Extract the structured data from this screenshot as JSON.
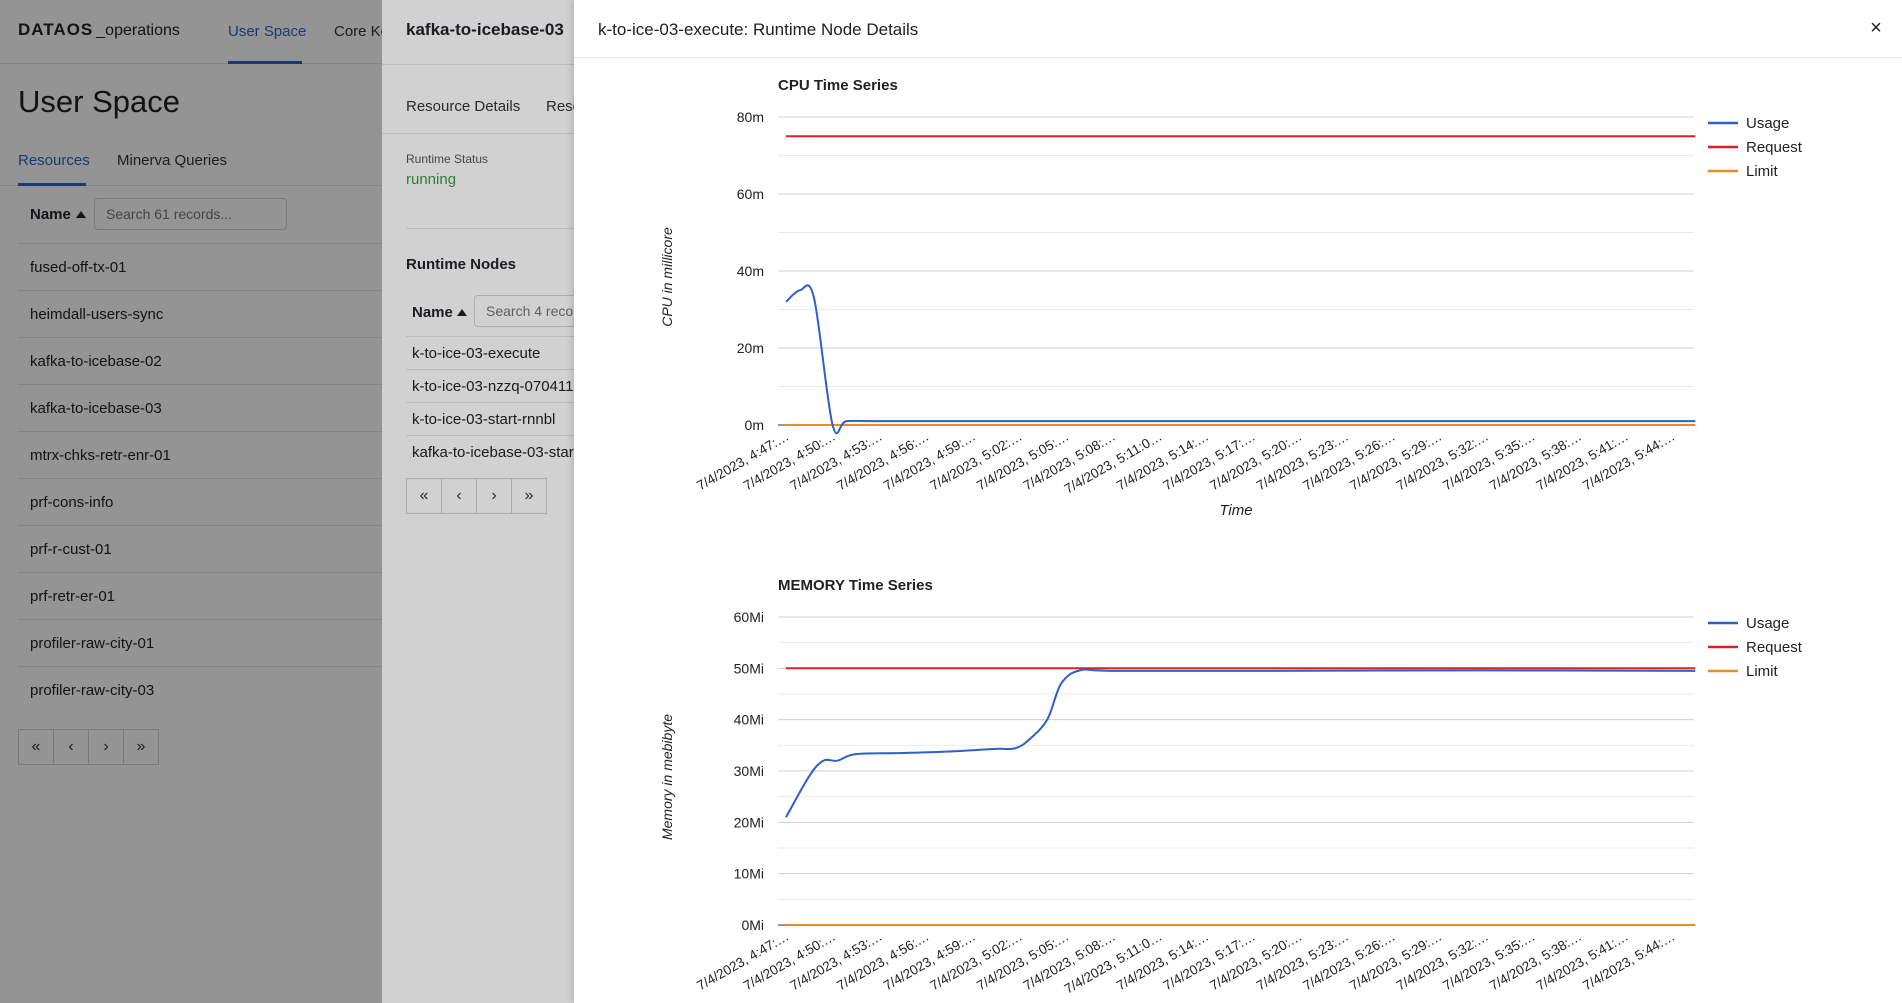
{
  "app": {
    "logo_brand": "DATAOS",
    "logo_suffix": "_operations",
    "nav": [
      {
        "label": "User Space",
        "active": true
      },
      {
        "label": "Core Ke"
      }
    ]
  },
  "user_space": {
    "title": "User Space",
    "tabs": [
      {
        "label": "Resources",
        "active": true
      },
      {
        "label": "Minerva Queries"
      }
    ],
    "table": {
      "name_header": "Name",
      "search_placeholder": "Search 61 records...",
      "rows": [
        "fused-off-tx-01",
        "heimdall-users-sync",
        "kafka-to-icebase-02",
        "kafka-to-icebase-03",
        "mtrx-chks-retr-enr-01",
        "prf-cons-info",
        "prf-r-cust-01",
        "prf-retr-er-01",
        "profiler-raw-city-01",
        "profiler-raw-city-03"
      ]
    },
    "pager": [
      "«",
      "‹",
      "›",
      "»"
    ]
  },
  "resource_panel": {
    "title": "kafka-to-icebase-03",
    "tabs": [
      "Resource Details",
      "Reso"
    ],
    "runtime_status_label": "Runtime Status",
    "runtime_status_value": "running",
    "runtime_nodes_title": "Runtime Nodes",
    "name_header": "Name",
    "search_placeholder": "Search 4 reco",
    "nodes": [
      "k-to-ice-03-execute",
      "k-to-ice-03-nzzq-070411",
      "k-to-ice-03-start-rnnbl",
      "kafka-to-icebase-03-star"
    ],
    "pager": [
      "«",
      "‹",
      "›",
      "»"
    ]
  },
  "details_drawer": {
    "title": "k-to-ice-03-execute: Runtime Node Details",
    "close_label": "×",
    "colors": {
      "usage": "#2f5fc8",
      "request": "#d6202c",
      "limit": "#f08a1c",
      "grid": "#d9d9d9"
    }
  },
  "chart_data": [
    {
      "type": "line",
      "title": "CPU Time Series",
      "xlabel": "Time",
      "ylabel": "CPU in millicore",
      "y_ticks": [
        "0m",
        "20m",
        "40m",
        "60m",
        "80m"
      ],
      "ylim": [
        0,
        80
      ],
      "x_ticks": [
        "7/4/2023, 4:47:…",
        "7/4/2023, 4:50:…",
        "7/4/2023, 4:53:…",
        "7/4/2023, 4:56:…",
        "7/4/2023, 4:59:…",
        "7/4/2023, 5:02:…",
        "7/4/2023, 5:05:…",
        "7/4/2023, 5:08:…",
        "7/4/2023, 5:11:0…",
        "7/4/2023, 5:14:…",
        "7/4/2023, 5:17:…",
        "7/4/2023, 5:20:…",
        "7/4/2023, 5:23:…",
        "7/4/2023, 5:26:…",
        "7/4/2023, 5:29:…",
        "7/4/2023, 5:32:…",
        "7/4/2023, 5:35:…",
        "7/4/2023, 5:38:…",
        "7/4/2023, 5:41:…",
        "7/4/2023, 5:44:…"
      ],
      "legend_position": "right",
      "series": [
        {
          "name": "Usage",
          "color": "#2f5fc8",
          "points": [
            [
              0,
              32
            ],
            [
              0.3,
              35
            ],
            [
              0.6,
              33
            ],
            [
              1.0,
              0
            ],
            [
              1.3,
              1
            ],
            [
              2,
              1
            ],
            [
              5,
              1
            ],
            [
              10,
              1
            ],
            [
              15,
              1
            ],
            [
              19.5,
              1
            ]
          ]
        },
        {
          "name": "Request",
          "color": "#d6202c",
          "points": [
            [
              0,
              75
            ],
            [
              19.5,
              75
            ]
          ]
        },
        {
          "name": "Limit",
          "color": "#f08a1c",
          "points": [
            [
              0,
              0
            ],
            [
              19.5,
              0
            ]
          ]
        }
      ]
    },
    {
      "type": "line",
      "title": "MEMORY Time Series",
      "xlabel": "",
      "ylabel": "Memory in mebibyte",
      "y_ticks": [
        "0Mi",
        "10Mi",
        "20Mi",
        "30Mi",
        "40Mi",
        "50Mi",
        "60Mi"
      ],
      "ylim": [
        0,
        60
      ],
      "x_ticks": [
        "7/4/2023, 4:47:…",
        "7/4/2023, 4:50:…",
        "7/4/2023, 4:53:…",
        "7/4/2023, 4:56:…",
        "7/4/2023, 4:59:…",
        "7/4/2023, 5:02:…",
        "7/4/2023, 5:05:…",
        "7/4/2023, 5:08:…",
        "7/4/2023, 5:11:0…",
        "7/4/2023, 5:14:…",
        "7/4/2023, 5:17:…",
        "7/4/2023, 5:20:…",
        "7/4/2023, 5:23:…",
        "7/4/2023, 5:26:…",
        "7/4/2023, 5:29:…",
        "7/4/2023, 5:32:…",
        "7/4/2023, 5:35:…",
        "7/4/2023, 5:38:…",
        "7/4/2023, 5:41:…",
        "7/4/2023, 5:44:…"
      ],
      "legend_position": "right",
      "series": [
        {
          "name": "Usage",
          "color": "#2f5fc8",
          "points": [
            [
              0,
              21
            ],
            [
              0.5,
              29
            ],
            [
              0.8,
              32
            ],
            [
              1.1,
              32
            ],
            [
              1.5,
              33.3
            ],
            [
              2.5,
              33.5
            ],
            [
              3.5,
              33.8
            ],
            [
              4.5,
              34.3
            ],
            [
              4.9,
              34.4
            ],
            [
              5.2,
              36
            ],
            [
              5.6,
              40
            ],
            [
              5.9,
              47
            ],
            [
              6.3,
              49.6
            ],
            [
              7,
              49.5
            ],
            [
              10,
              49.5
            ],
            [
              15,
              49.6
            ],
            [
              19.5,
              49.5
            ]
          ]
        },
        {
          "name": "Request",
          "color": "#d6202c",
          "points": [
            [
              0,
              50
            ],
            [
              19.5,
              50
            ]
          ]
        },
        {
          "name": "Limit",
          "color": "#f08a1c",
          "points": [
            [
              0,
              0
            ],
            [
              19.5,
              0
            ]
          ]
        }
      ]
    }
  ]
}
